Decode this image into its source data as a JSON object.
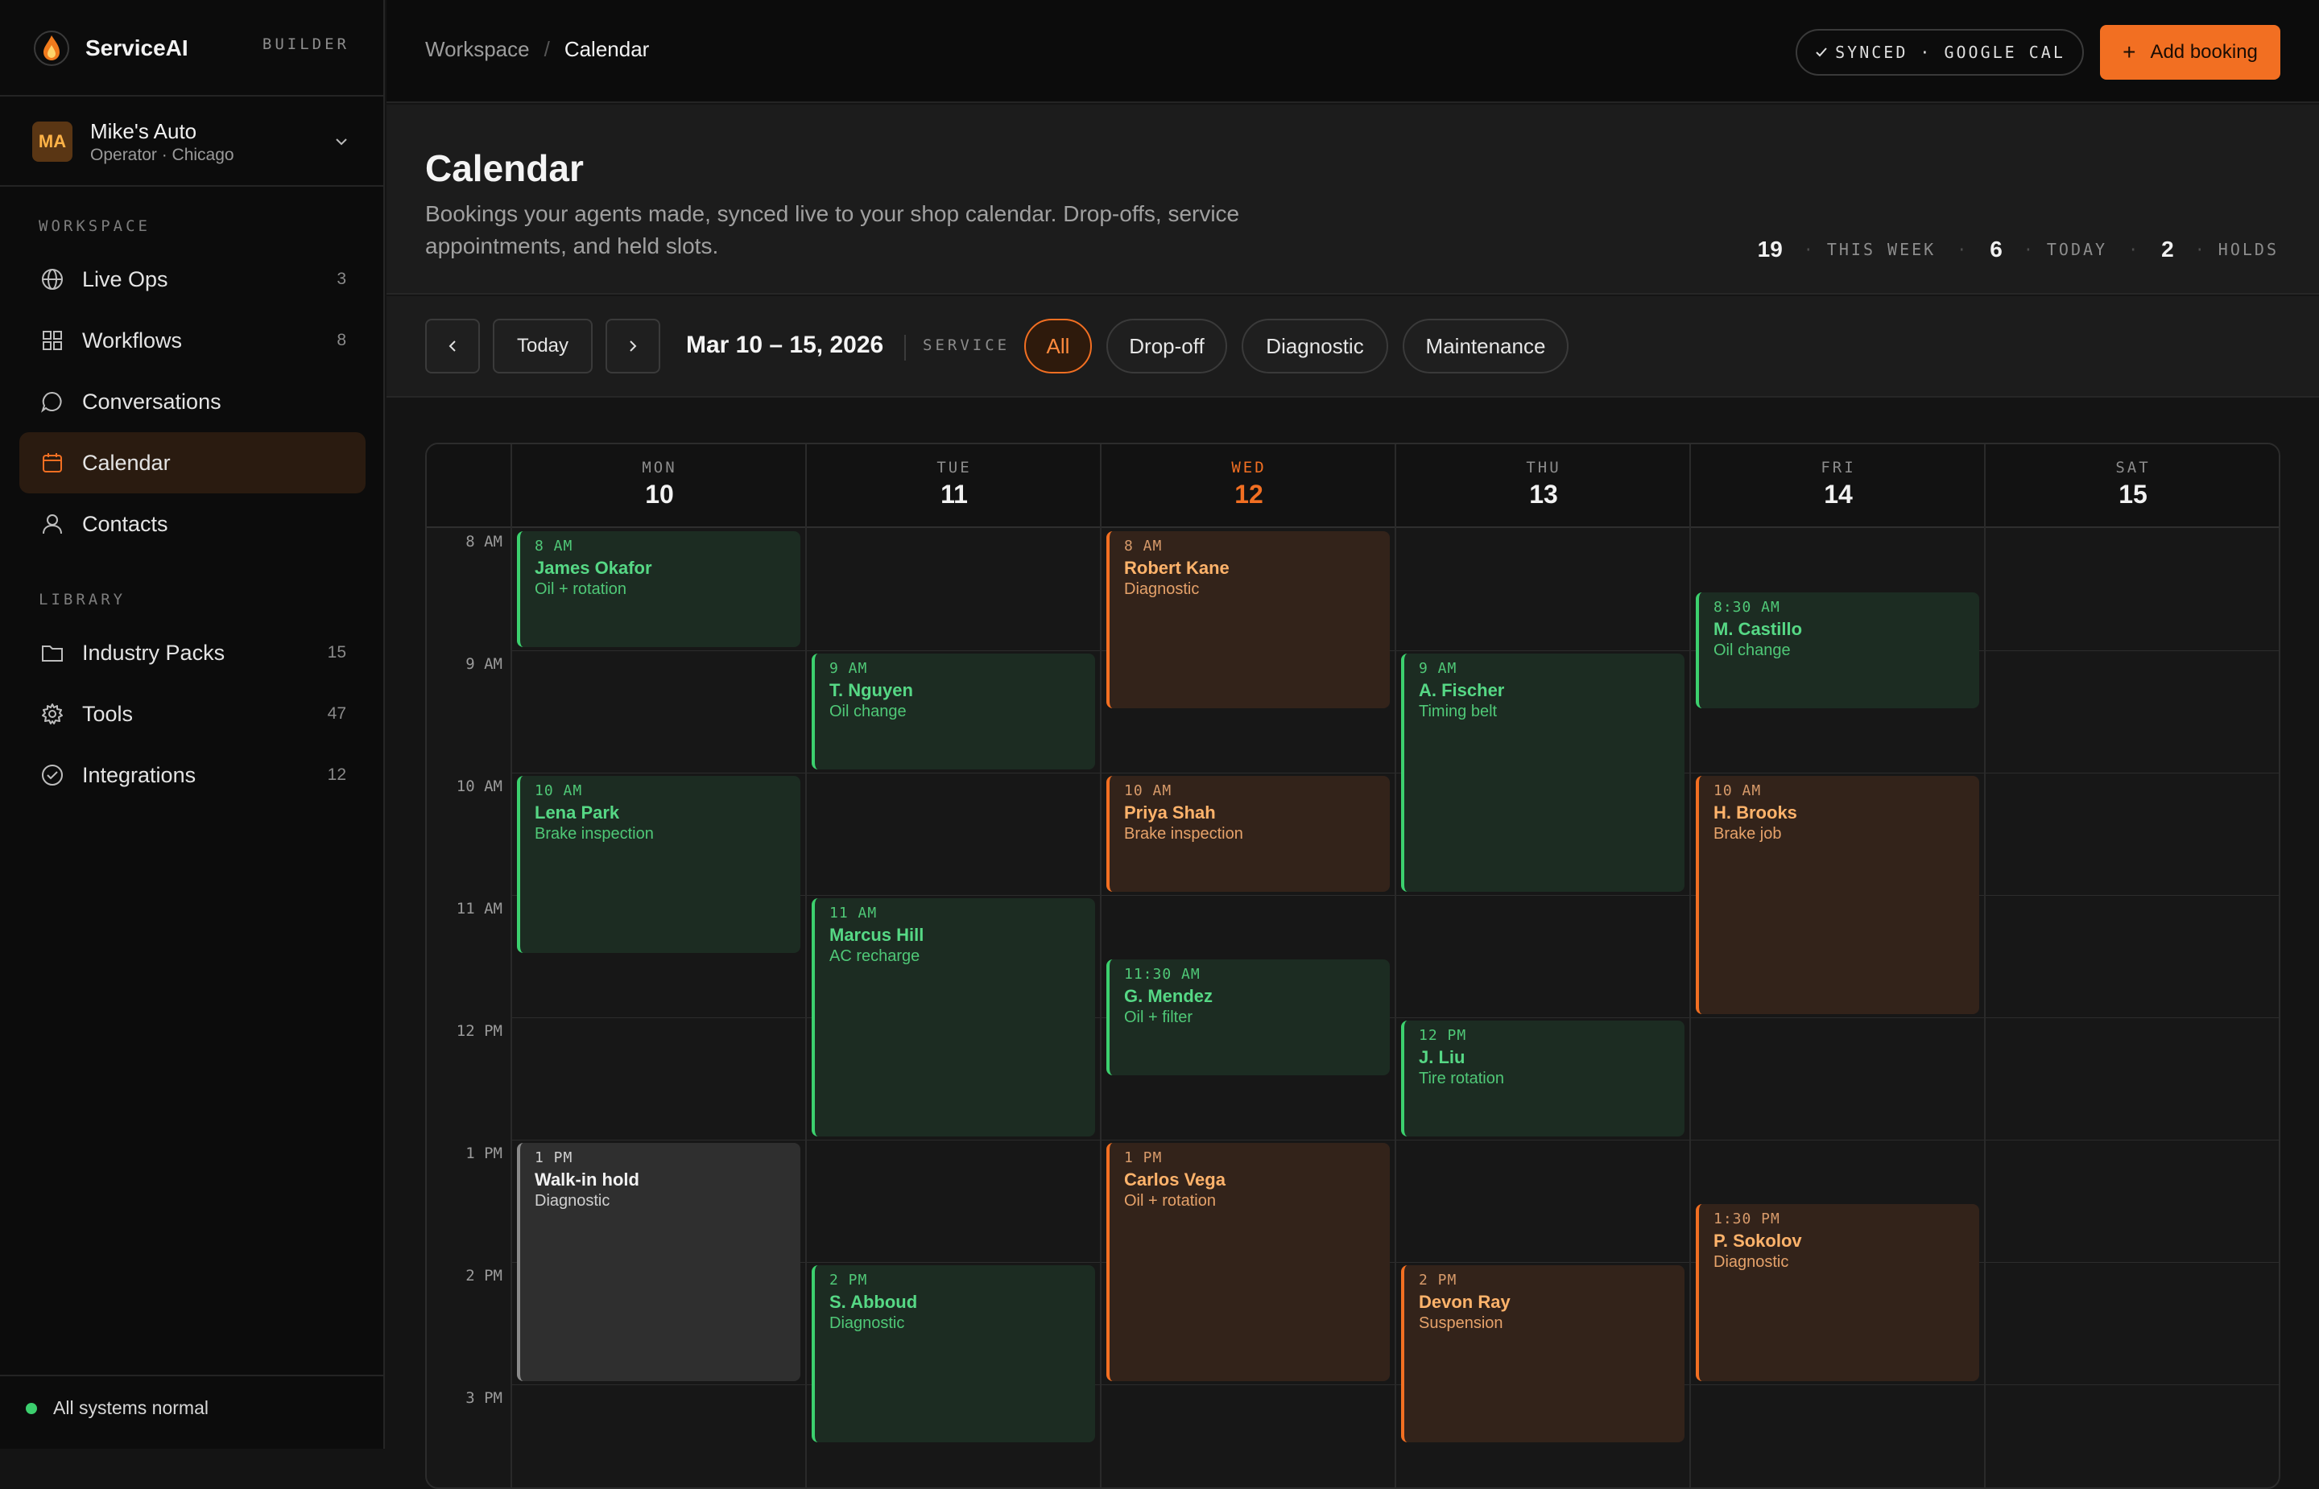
{
  "brand": {
    "name": "ServiceAI",
    "badge": "BUILDER"
  },
  "org": {
    "initials": "MA",
    "name": "Mike's Auto",
    "subtitle": "Operator · Chicago"
  },
  "sidebar": {
    "workspace_label": "WORKSPACE",
    "workspace_items": [
      {
        "label": "Live Ops",
        "count": "3",
        "icon": "globe-icon"
      },
      {
        "label": "Workflows",
        "count": "8",
        "icon": "grid-icon"
      },
      {
        "label": "Conversations",
        "count": "",
        "icon": "chat-icon"
      },
      {
        "label": "Calendar",
        "count": "",
        "icon": "calendar-icon",
        "active": true
      },
      {
        "label": "Contacts",
        "count": "",
        "icon": "user-icon"
      }
    ],
    "library_label": "LIBRARY",
    "library_items": [
      {
        "label": "Industry Packs",
        "count": "15",
        "icon": "folder-icon"
      },
      {
        "label": "Tools",
        "count": "47",
        "icon": "gear-icon"
      },
      {
        "label": "Integrations",
        "count": "12",
        "icon": "check-circle-icon"
      }
    ],
    "status": "All systems normal"
  },
  "topbar": {
    "breadcrumb": [
      "Workspace",
      "/",
      "Calendar"
    ],
    "sync_status": "SYNCED · GOOGLE CAL",
    "add_button": "Add booking"
  },
  "header": {
    "title": "Calendar",
    "subtitle": "Bookings your agents made, synced live to your shop calendar. Drop-offs, service appointments, and held slots.",
    "stats": [
      {
        "value": "19",
        "label": "THIS WEEK"
      },
      {
        "value": "6",
        "label": "TODAY"
      },
      {
        "value": "2",
        "label": "HOLDS"
      }
    ]
  },
  "toolbar": {
    "today_label": "Today",
    "range": "Mar 10 – 15, 2026",
    "filter_label": "SERVICE",
    "filters": [
      "All",
      "Drop-off",
      "Diagnostic",
      "Maintenance"
    ],
    "active_filter": "All"
  },
  "calendar": {
    "days": [
      {
        "abbr": "MON",
        "num": "10"
      },
      {
        "abbr": "TUE",
        "num": "11"
      },
      {
        "abbr": "WED",
        "num": "12",
        "today": true
      },
      {
        "abbr": "THU",
        "num": "13"
      },
      {
        "abbr": "FRI",
        "num": "14"
      },
      {
        "abbr": "SAT",
        "num": "15"
      }
    ],
    "hours": [
      "8 AM",
      "9 AM",
      "10 AM",
      "11 AM",
      "12 PM",
      "1 PM",
      "2 PM",
      "3 PM"
    ],
    "colors": {
      "green": "#3cd06e",
      "orange": "#f26f22",
      "gray": "#8a8a8a"
    },
    "events": [
      {
        "day": 0,
        "start": 8,
        "end": 9,
        "time": "8 AM",
        "name": "James Okafor",
        "service": "Oil + rotation",
        "kind": "green"
      },
      {
        "day": 0,
        "start": 10,
        "end": 11.5,
        "time": "10 AM",
        "name": "Lena Park",
        "service": "Brake inspection",
        "kind": "green"
      },
      {
        "day": 0,
        "start": 13,
        "end": 15,
        "time": "1 PM",
        "name": "Walk-in hold",
        "service": "Diagnostic",
        "kind": "gray"
      },
      {
        "day": 1,
        "start": 9,
        "end": 10,
        "time": "9 AM",
        "name": "T. Nguyen",
        "service": "Oil change",
        "kind": "green"
      },
      {
        "day": 1,
        "start": 11,
        "end": 13,
        "time": "11 AM",
        "name": "Marcus Hill",
        "service": "AC recharge",
        "kind": "green"
      },
      {
        "day": 1,
        "start": 14,
        "end": 15.5,
        "time": "2 PM",
        "name": "S. Abboud",
        "service": "Diagnostic",
        "kind": "green"
      },
      {
        "day": 2,
        "start": 8,
        "end": 9.5,
        "time": "8 AM",
        "name": "Robert Kane",
        "service": "Diagnostic",
        "kind": "orange"
      },
      {
        "day": 2,
        "start": 10,
        "end": 11,
        "time": "10 AM",
        "name": "Priya Shah",
        "service": "Brake inspection",
        "kind": "orange"
      },
      {
        "day": 2,
        "start": 11.5,
        "end": 12.5,
        "time": "11:30 AM",
        "name": "G. Mendez",
        "service": "Oil + filter",
        "kind": "green"
      },
      {
        "day": 2,
        "start": 13,
        "end": 15,
        "time": "1 PM",
        "name": "Carlos Vega",
        "service": "Oil + rotation",
        "kind": "orange"
      },
      {
        "day": 3,
        "start": 9,
        "end": 11,
        "time": "9 AM",
        "name": "A. Fischer",
        "service": "Timing belt",
        "kind": "green"
      },
      {
        "day": 3,
        "start": 12,
        "end": 13,
        "time": "12 PM",
        "name": "J. Liu",
        "service": "Tire rotation",
        "kind": "green"
      },
      {
        "day": 3,
        "start": 14,
        "end": 15.5,
        "time": "2 PM",
        "name": "Devon Ray",
        "service": "Suspension",
        "kind": "orange"
      },
      {
        "day": 4,
        "start": 8.5,
        "end": 9.5,
        "time": "8:30 AM",
        "name": "M. Castillo",
        "service": "Oil change",
        "kind": "green"
      },
      {
        "day": 4,
        "start": 10,
        "end": 12,
        "time": "10 AM",
        "name": "H. Brooks",
        "service": "Brake job",
        "kind": "orange"
      },
      {
        "day": 4,
        "start": 13.5,
        "end": 15,
        "time": "1:30 PM",
        "name": "P. Sokolov",
        "service": "Diagnostic",
        "kind": "orange"
      }
    ]
  }
}
